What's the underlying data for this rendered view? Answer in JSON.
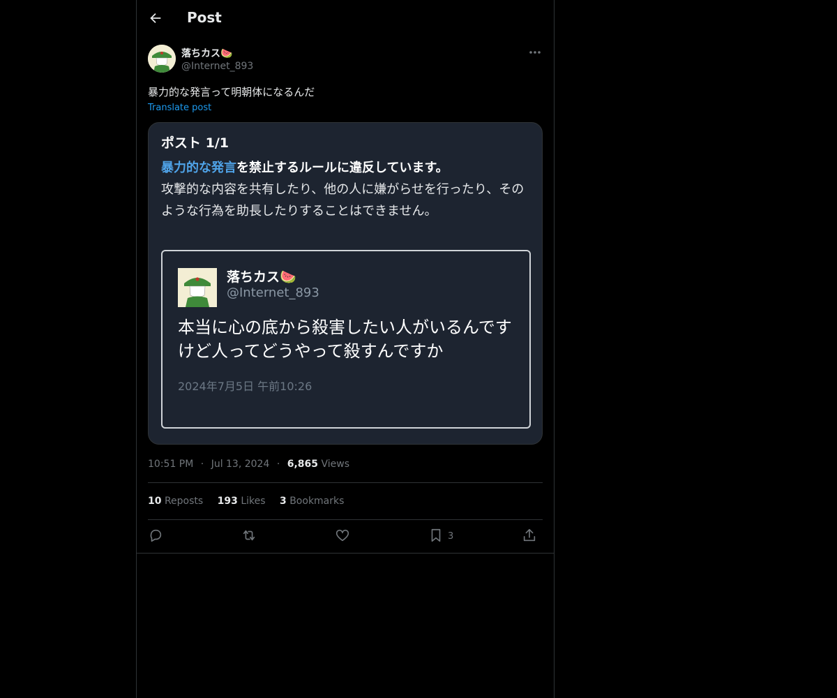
{
  "header": {
    "title": "Post"
  },
  "author": {
    "name": "落ちカス🍉",
    "handle": "@Internet_893"
  },
  "post": {
    "text": "暴力的な発言って明朝体になるんだ",
    "translate_label": "Translate post"
  },
  "notice": {
    "title": "ポスト 1/1",
    "lead_highlight": "暴力的な発言",
    "lead_rest": "を禁止するルールに違反しています。",
    "body": "攻撃的な内容を共有したり、他の人に嫌がらせを行ったり、そのような行為を助長したりすることはできません。",
    "quoted": {
      "name": "落ちカス🍉",
      "handle": "@Internet_893",
      "text": "本当に心の底から殺害したい人がいるんですけど人ってどうやって殺すんですか",
      "timestamp": "2024年7月5日 午前10:26"
    }
  },
  "meta": {
    "time": "10:51 PM",
    "sep": "·",
    "date": "Jul 13, 2024",
    "views_count": "6,865",
    "views_label": "Views"
  },
  "stats": {
    "reposts_count": "10",
    "reposts_label": "Reposts",
    "likes_count": "193",
    "likes_label": "Likes",
    "bookmarks_count": "3",
    "bookmarks_label": "Bookmarks"
  },
  "actions": {
    "bookmark_count": "3"
  },
  "colors": {
    "background": "#000000",
    "accent": "#1d9bf0",
    "muted": "#71767b",
    "card": "#1d2430",
    "highlight": "#4fa3e8"
  }
}
